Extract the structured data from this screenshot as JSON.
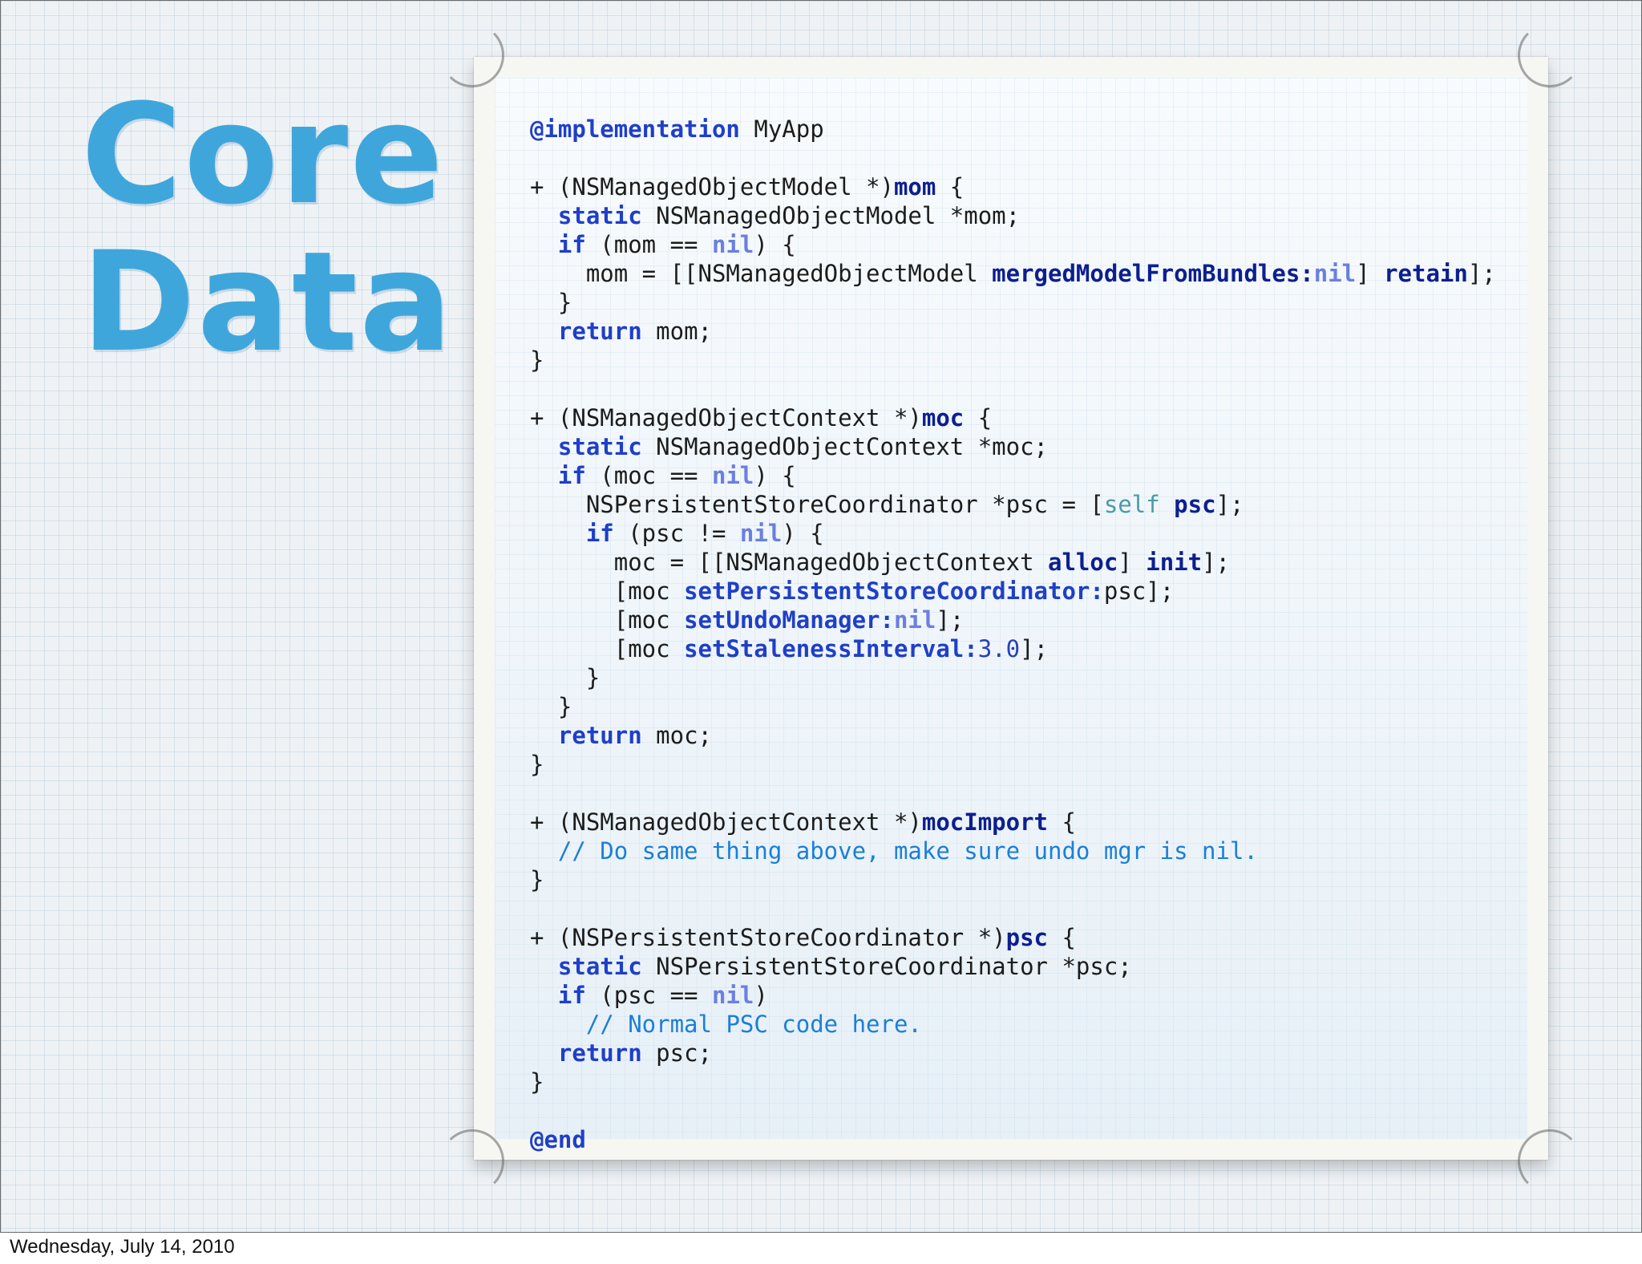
{
  "title_lines": [
    "Core",
    "Data"
  ],
  "footer_date": "Wednesday, July 14, 2010",
  "colors": {
    "title": "#3fa6dc",
    "keyword": "#1f3fc8",
    "selector": "#0d1f8f",
    "nil": "#6b7fe0",
    "self": "#4a9aa8",
    "number": "#2840b8",
    "comment": "#1a7fd8"
  },
  "code_lines": [
    [
      [
        "@implementation",
        "kw"
      ],
      [
        " MyApp",
        "plain"
      ]
    ],
    [],
    [
      [
        "+ (NSManagedObjectModel *)",
        "plain"
      ],
      [
        "mom",
        "sel"
      ],
      [
        " {",
        "plain"
      ]
    ],
    [
      [
        "  ",
        "plain"
      ],
      [
        "static",
        "kw"
      ],
      [
        " NSManagedObjectModel *mom;",
        "plain"
      ]
    ],
    [
      [
        "  ",
        "plain"
      ],
      [
        "if",
        "kw"
      ],
      [
        " (mom == ",
        "plain"
      ],
      [
        "nil",
        "nil"
      ],
      [
        ") {",
        "plain"
      ]
    ],
    [
      [
        "    mom = [[NSManagedObjectModel ",
        "plain"
      ],
      [
        "mergedModelFromBundles:",
        "sel"
      ],
      [
        "nil",
        "nil"
      ],
      [
        "] ",
        "plain"
      ],
      [
        "retain",
        "sel"
      ],
      [
        "];",
        "plain"
      ]
    ],
    [
      [
        "  }",
        "plain"
      ]
    ],
    [
      [
        "  ",
        "plain"
      ],
      [
        "return",
        "kw"
      ],
      [
        " mom;",
        "plain"
      ]
    ],
    [
      [
        "}",
        "plain"
      ]
    ],
    [],
    [
      [
        "+ (NSManagedObjectContext *)",
        "plain"
      ],
      [
        "moc",
        "sel"
      ],
      [
        " {",
        "plain"
      ]
    ],
    [
      [
        "  ",
        "plain"
      ],
      [
        "static",
        "kw"
      ],
      [
        " NSManagedObjectContext *moc;",
        "plain"
      ]
    ],
    [
      [
        "  ",
        "plain"
      ],
      [
        "if",
        "kw"
      ],
      [
        " (moc == ",
        "plain"
      ],
      [
        "nil",
        "nil"
      ],
      [
        ") {",
        "plain"
      ]
    ],
    [
      [
        "    NSPersistentStoreCoordinator *psc = [",
        "plain"
      ],
      [
        "self",
        "self"
      ],
      [
        " ",
        "plain"
      ],
      [
        "psc",
        "sel"
      ],
      [
        "];",
        "plain"
      ]
    ],
    [
      [
        "    ",
        "plain"
      ],
      [
        "if",
        "kw"
      ],
      [
        " (psc != ",
        "plain"
      ],
      [
        "nil",
        "nil"
      ],
      [
        ") {",
        "plain"
      ]
    ],
    [
      [
        "      moc = [[NSManagedObjectContext ",
        "plain"
      ],
      [
        "alloc",
        "sel"
      ],
      [
        "] ",
        "plain"
      ],
      [
        "init",
        "sel"
      ],
      [
        "];",
        "plain"
      ]
    ],
    [
      [
        "      [moc ",
        "plain"
      ],
      [
        "setPersistentStoreCoordinator:",
        "kw"
      ],
      [
        "psc];",
        "plain"
      ]
    ],
    [
      [
        "      [moc ",
        "plain"
      ],
      [
        "setUndoManager:",
        "kw"
      ],
      [
        "nil",
        "nil"
      ],
      [
        "];",
        "plain"
      ]
    ],
    [
      [
        "      [moc ",
        "plain"
      ],
      [
        "setStalenessInterval:",
        "kw"
      ],
      [
        "3.0",
        "num"
      ],
      [
        "];",
        "plain"
      ]
    ],
    [
      [
        "    }",
        "plain"
      ]
    ],
    [
      [
        "  }",
        "plain"
      ]
    ],
    [
      [
        "  ",
        "plain"
      ],
      [
        "return",
        "kw"
      ],
      [
        " moc;",
        "plain"
      ]
    ],
    [
      [
        "}",
        "plain"
      ]
    ],
    [],
    [
      [
        "+ (NSManagedObjectContext *)",
        "plain"
      ],
      [
        "mocImport",
        "sel"
      ],
      [
        " {",
        "plain"
      ]
    ],
    [
      [
        "  ",
        "plain"
      ],
      [
        "// Do same thing above, make sure undo mgr is nil.",
        "cmt"
      ]
    ],
    [
      [
        "}",
        "plain"
      ]
    ],
    [],
    [
      [
        "+ (NSPersistentStoreCoordinator *)",
        "plain"
      ],
      [
        "psc",
        "sel"
      ],
      [
        " {",
        "plain"
      ]
    ],
    [
      [
        "  ",
        "plain"
      ],
      [
        "static",
        "kw"
      ],
      [
        " NSPersistentStoreCoordinator *psc;",
        "plain"
      ]
    ],
    [
      [
        "  ",
        "plain"
      ],
      [
        "if",
        "kw"
      ],
      [
        " (psc == ",
        "plain"
      ],
      [
        "nil",
        "nil"
      ],
      [
        ")",
        "plain"
      ]
    ],
    [
      [
        "    ",
        "plain"
      ],
      [
        "// Normal PSC code here.",
        "cmt"
      ]
    ],
    [
      [
        "  ",
        "plain"
      ],
      [
        "return",
        "kw"
      ],
      [
        " psc;",
        "plain"
      ]
    ],
    [
      [
        "}",
        "plain"
      ]
    ],
    [],
    [
      [
        "@end",
        "kw"
      ]
    ]
  ]
}
